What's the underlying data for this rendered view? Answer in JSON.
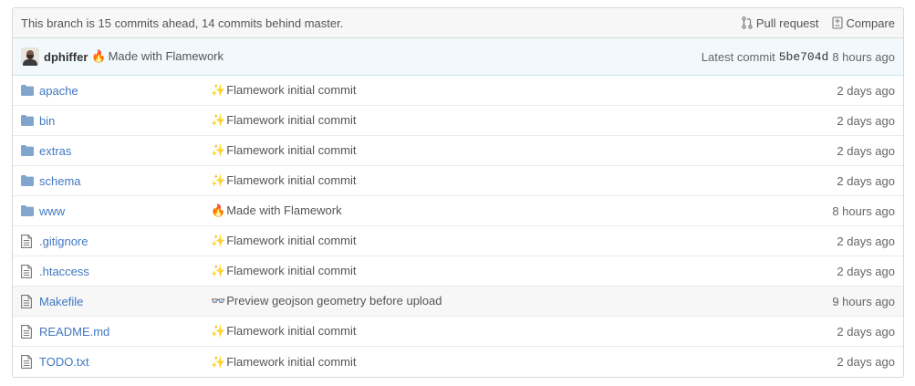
{
  "branch_bar": {
    "status": "This branch is 15 commits ahead, 14 commits behind master.",
    "pull_request": "Pull request",
    "compare": "Compare"
  },
  "latest_commit": {
    "author": "dphiffer",
    "emoji": "🔥",
    "message": "Made with Flamework",
    "label": "Latest commit",
    "sha": "5be704d",
    "age": "8 hours ago"
  },
  "files": [
    {
      "type": "directory",
      "name": "apache",
      "emoji": "✨",
      "message": "Flamework initial commit",
      "age": "2 days ago"
    },
    {
      "type": "directory",
      "name": "bin",
      "emoji": "✨",
      "message": "Flamework initial commit",
      "age": "2 days ago"
    },
    {
      "type": "directory",
      "name": "extras",
      "emoji": "✨",
      "message": "Flamework initial commit",
      "age": "2 days ago"
    },
    {
      "type": "directory",
      "name": "schema",
      "emoji": "✨",
      "message": "Flamework initial commit",
      "age": "2 days ago"
    },
    {
      "type": "directory",
      "name": "www",
      "emoji": "🔥",
      "message": "Made with Flamework",
      "age": "8 hours ago"
    },
    {
      "type": "file",
      "name": ".gitignore",
      "emoji": "✨",
      "message": "Flamework initial commit",
      "age": "2 days ago"
    },
    {
      "type": "file",
      "name": ".htaccess",
      "emoji": "✨",
      "message": "Flamework initial commit",
      "age": "2 days ago"
    },
    {
      "type": "file",
      "name": "Makefile",
      "emoji": "👓",
      "message": "Preview geojson geometry before upload",
      "age": "9 hours ago"
    },
    {
      "type": "file",
      "name": "README.md",
      "emoji": "✨",
      "message": "Flamework initial commit",
      "age": "2 days ago"
    },
    {
      "type": "file",
      "name": "TODO.txt",
      "emoji": "✨",
      "message": "Flamework initial commit",
      "age": "2 days ago"
    }
  ],
  "colors": {
    "link": "#4078c0",
    "folder_icon": "#80a6cd",
    "highlight_row": "#f7f7f7",
    "commit_tease_bg": "#f2f9fc"
  }
}
